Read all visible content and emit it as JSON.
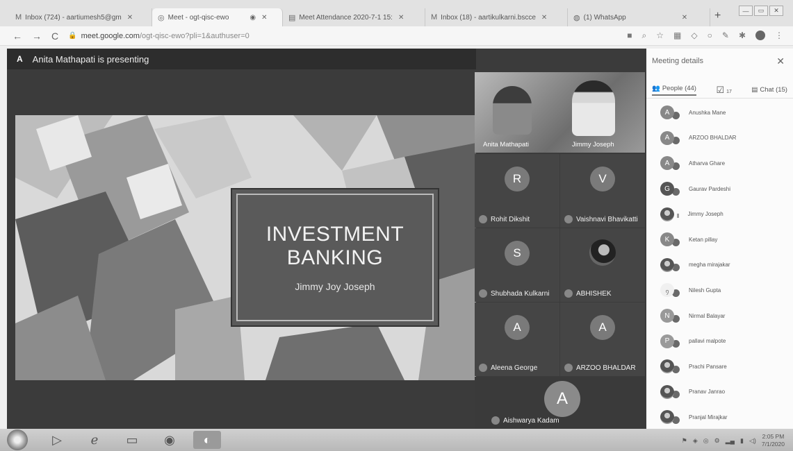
{
  "browser": {
    "tabs": [
      {
        "icon": "M",
        "label": "Inbox (724) - aartiumesh5@gm",
        "active": false
      },
      {
        "icon": "◎",
        "label": "Meet - ogt-qisc-ewo",
        "active": true
      },
      {
        "icon": "▤",
        "label": "Meet Attendance 2020-7-1 15:",
        "active": false
      },
      {
        "icon": "M",
        "label": "Inbox (18) - aartikulkarni.bscce",
        "active": false
      },
      {
        "icon": "◍",
        "label": "(1) WhatsApp",
        "active": false
      }
    ],
    "url_host": "meet.google.com",
    "url_path": "/ogt-qisc-ewo?pli=1&authuser=0"
  },
  "meet": {
    "presenter_letter": "A",
    "presenter_text": "Anita Mathapati is presenting",
    "slide": {
      "title_line1": "INVESTMENT",
      "title_line2": "BANKING",
      "subtitle": "Jimmy Joy Joseph"
    },
    "video_names": [
      "Anita Mathapati",
      "Jimmy Joseph"
    ],
    "tiles": [
      {
        "letter": "R",
        "name": "Rohit Dikshit"
      },
      {
        "letter": "V",
        "name": "Vaishnavi Bhavikatti"
      },
      {
        "letter": "S",
        "name": "Shubhada Kulkarni"
      },
      {
        "letter": "",
        "name": "ABHISHEK"
      },
      {
        "letter": "A",
        "name": "Aleena George"
      },
      {
        "letter": "A",
        "name": "ARZOO BHALDAR"
      },
      {
        "letter": "A",
        "name": "Aishwarya Kadam"
      }
    ]
  },
  "panel": {
    "title": "Meeting details",
    "people_tab": "People (44)",
    "activities_count": "17",
    "chat_tab": "Chat (15)",
    "people": [
      {
        "initial": "A",
        "name": "Anushka Mane"
      },
      {
        "initial": "A",
        "name": "ARZOO BHALDAR"
      },
      {
        "initial": "A",
        "name": "Atharva Ghare"
      },
      {
        "initial": "G",
        "name": "Gaurav Pardeshi"
      },
      {
        "initial": "",
        "name": "Jimmy Joseph"
      },
      {
        "initial": "K",
        "name": "Ketan pillay"
      },
      {
        "initial": "",
        "name": "megha mirajakar"
      },
      {
        "initial": "",
        "name": "Nilesh Gupta"
      },
      {
        "initial": "N",
        "name": "Nirmal Balayar"
      },
      {
        "initial": "P",
        "name": "pallavi malpote"
      },
      {
        "initial": "",
        "name": "Prachi Pansare"
      },
      {
        "initial": "",
        "name": "Pranav Janrao"
      },
      {
        "initial": "",
        "name": "Pranjal Mirajkar"
      }
    ]
  },
  "taskbar": {
    "time": "2:05 PM",
    "date": "7/1/2020"
  }
}
